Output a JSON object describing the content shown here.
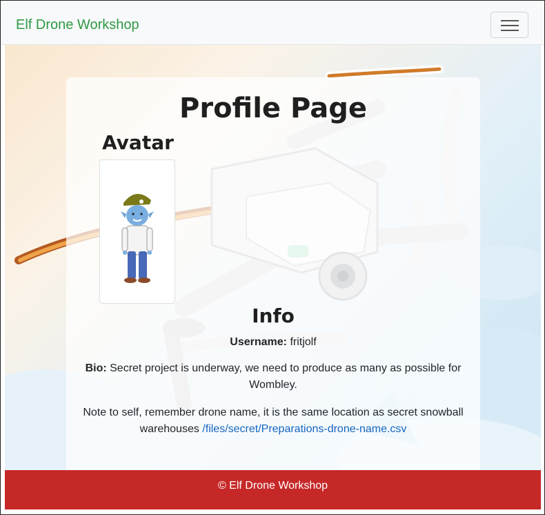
{
  "navbar": {
    "brand": "Elf Drone Workshop",
    "menu_icon": "hamburger-menu-icon"
  },
  "profile": {
    "title": "Profile Page",
    "avatar_heading": "Avatar",
    "avatar_icon": "elf-avatar-icon",
    "info_heading": "Info",
    "username_label": "Username:",
    "username_value": "fritjolf",
    "bio_label": "Bio:",
    "bio_text": "Secret project is underway, we need to produce as many as possible for Wombley.",
    "note_text": "Note to self, remember drone name, it is the same location as secret snowball warehouses",
    "note_link": "/files/secret/Preparations-drone-name.csv"
  },
  "footer": {
    "copyright": "© Elf Drone Workshop"
  },
  "colors": {
    "brand_green": "#2e9a45",
    "footer_red": "#c62828",
    "link_blue": "#1565c0"
  }
}
